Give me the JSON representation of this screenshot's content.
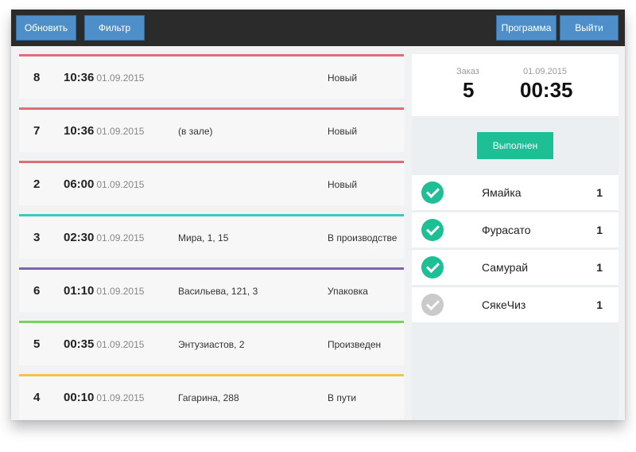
{
  "toolbar": {
    "refresh_label": "Обновить",
    "filter_label": "Фильтр",
    "program_label": "Программа",
    "exit_label": "Выйти"
  },
  "orders": [
    {
      "number": "8",
      "time": "10:36",
      "date": "01.09.2015",
      "address": "",
      "status": "Новый",
      "color": "#e06c78"
    },
    {
      "number": "7",
      "time": "10:36",
      "date": "01.09.2015",
      "address": "(в зале)",
      "status": "Новый",
      "color": "#e06c78"
    },
    {
      "number": "2",
      "time": "06:00",
      "date": "01.09.2015",
      "address": "",
      "status": "Новый",
      "color": "#e06c78"
    },
    {
      "number": "3",
      "time": "02:30",
      "date": "01.09.2015",
      "address": "Мира, 1, 15",
      "status": "В производстве",
      "color": "#3cc8c0"
    },
    {
      "number": "6",
      "time": "01:10",
      "date": "01.09.2015",
      "address": "Васильева, 121, 3",
      "status": "Упаковка",
      "color": "#7b63b0"
    },
    {
      "number": "5",
      "time": "00:35",
      "date": "01.09.2015",
      "address": "Энтузиастов, 2",
      "status": "Произведен",
      "color": "#7ad35a"
    },
    {
      "number": "4",
      "time": "00:10",
      "date": "01.09.2015",
      "address": "Гагарина, 288",
      "status": "В пути",
      "color": "#f2c34e"
    }
  ],
  "detail": {
    "order_label": "Заказ",
    "order_number": "5",
    "date": "01.09.2015",
    "time": "00:35",
    "done_label": "Выполнен",
    "items": [
      {
        "name": "Ямайка",
        "qty": "1",
        "checked": true
      },
      {
        "name": "Фурасато",
        "qty": "1",
        "checked": true
      },
      {
        "name": "Самурай",
        "qty": "1",
        "checked": true
      },
      {
        "name": "СякеЧиз",
        "qty": "1",
        "checked": false
      }
    ]
  },
  "colors": {
    "accent_blue": "#4f8fc9",
    "success_green": "#1fbf96",
    "toolbar_dark": "#2b2b2b"
  }
}
